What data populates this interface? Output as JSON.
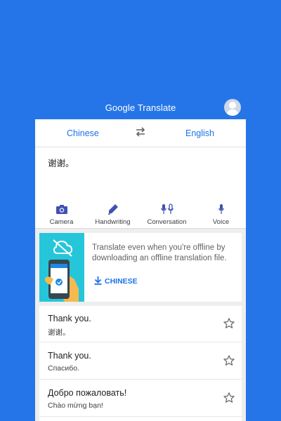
{
  "header": {
    "logo_text": "Google Translate",
    "logo_google": "Google",
    "logo_translate": "Translate",
    "avatar_icon": "account-circle-icon"
  },
  "language_bar": {
    "source": "Chinese",
    "target": "English",
    "swap_icon": "swap-horiz-icon"
  },
  "input": {
    "text": "谢谢。"
  },
  "tools": [
    {
      "label": "Camera",
      "icon": "camera-icon"
    },
    {
      "label": "Handwriting",
      "icon": "pen-icon"
    },
    {
      "label": "Conversation",
      "icon": "double-mic-icon"
    },
    {
      "label": "Voice",
      "icon": "mic-icon"
    }
  ],
  "offline_card": {
    "message": "Translate even when you're offline by downloading an offline translation file.",
    "download_label": "CHINESE",
    "download_icon": "download-icon"
  },
  "history": [
    {
      "source": "Thank you.",
      "translation": "谢谢。"
    },
    {
      "source": "Thank you.",
      "translation": "Спасибо."
    },
    {
      "source": "Добро пожаловать!",
      "translation": "Chào mừng bạn!"
    }
  ],
  "colors": {
    "background": "#2575e8",
    "accent": "#1a73e8",
    "offline_art": "#26c6da",
    "tool_icon": "#3f51b5"
  }
}
